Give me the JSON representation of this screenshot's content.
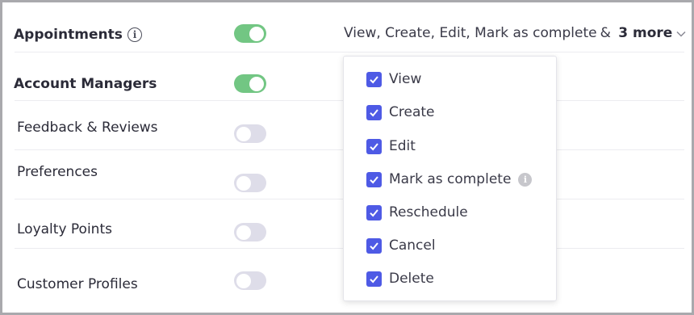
{
  "rows": [
    {
      "label": "Appointments",
      "enabled": true,
      "has_info": true
    },
    {
      "label": "Account Managers",
      "enabled": true,
      "has_info": false
    },
    {
      "label": "Feedback & Reviews",
      "enabled": false,
      "has_info": false
    },
    {
      "label": "Preferences",
      "enabled": false,
      "has_info": false
    },
    {
      "label": "Loyalty Points",
      "enabled": false,
      "has_info": false
    },
    {
      "label": "Customer Profiles",
      "enabled": false,
      "has_info": false
    }
  ],
  "permissions_summary": {
    "text": "View, Create, Edit, Mark as complete",
    "conjunction": "&",
    "more_label": "3 more"
  },
  "permissions_options": [
    {
      "label": "View",
      "checked": true,
      "has_info": false
    },
    {
      "label": "Create",
      "checked": true,
      "has_info": false
    },
    {
      "label": "Edit",
      "checked": true,
      "has_info": false
    },
    {
      "label": "Mark as complete",
      "checked": true,
      "has_info": true
    },
    {
      "label": "Reschedule",
      "checked": true,
      "has_info": false
    },
    {
      "label": "Cancel",
      "checked": true,
      "has_info": false
    },
    {
      "label": "Delete",
      "checked": true,
      "has_info": false
    }
  ],
  "icons": {
    "info": "info-icon",
    "chevron": "chevron-down-icon",
    "check": "checkmark-icon"
  },
  "colors": {
    "toggle_on": "#72c683",
    "toggle_off": "#dedde9",
    "checkbox": "#4e5ae5",
    "border": "#a9a9ad"
  }
}
